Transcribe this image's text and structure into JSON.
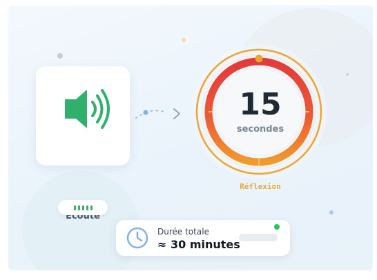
{
  "audio": {
    "label": "Écoute",
    "icon": "speaker-icon"
  },
  "timer": {
    "value": "15",
    "unit": "secondes",
    "phase": "Réflexion"
  },
  "total": {
    "caption": "Durée totale",
    "value": "≈ 30 minutes",
    "icon": "clock-icon"
  },
  "colors": {
    "accent_green": "#2fb16b",
    "ring_red": "#e8473a",
    "ring_orange": "#f39a2b",
    "phase_label": "#e9a93a",
    "status_dot": "#22c55e"
  }
}
